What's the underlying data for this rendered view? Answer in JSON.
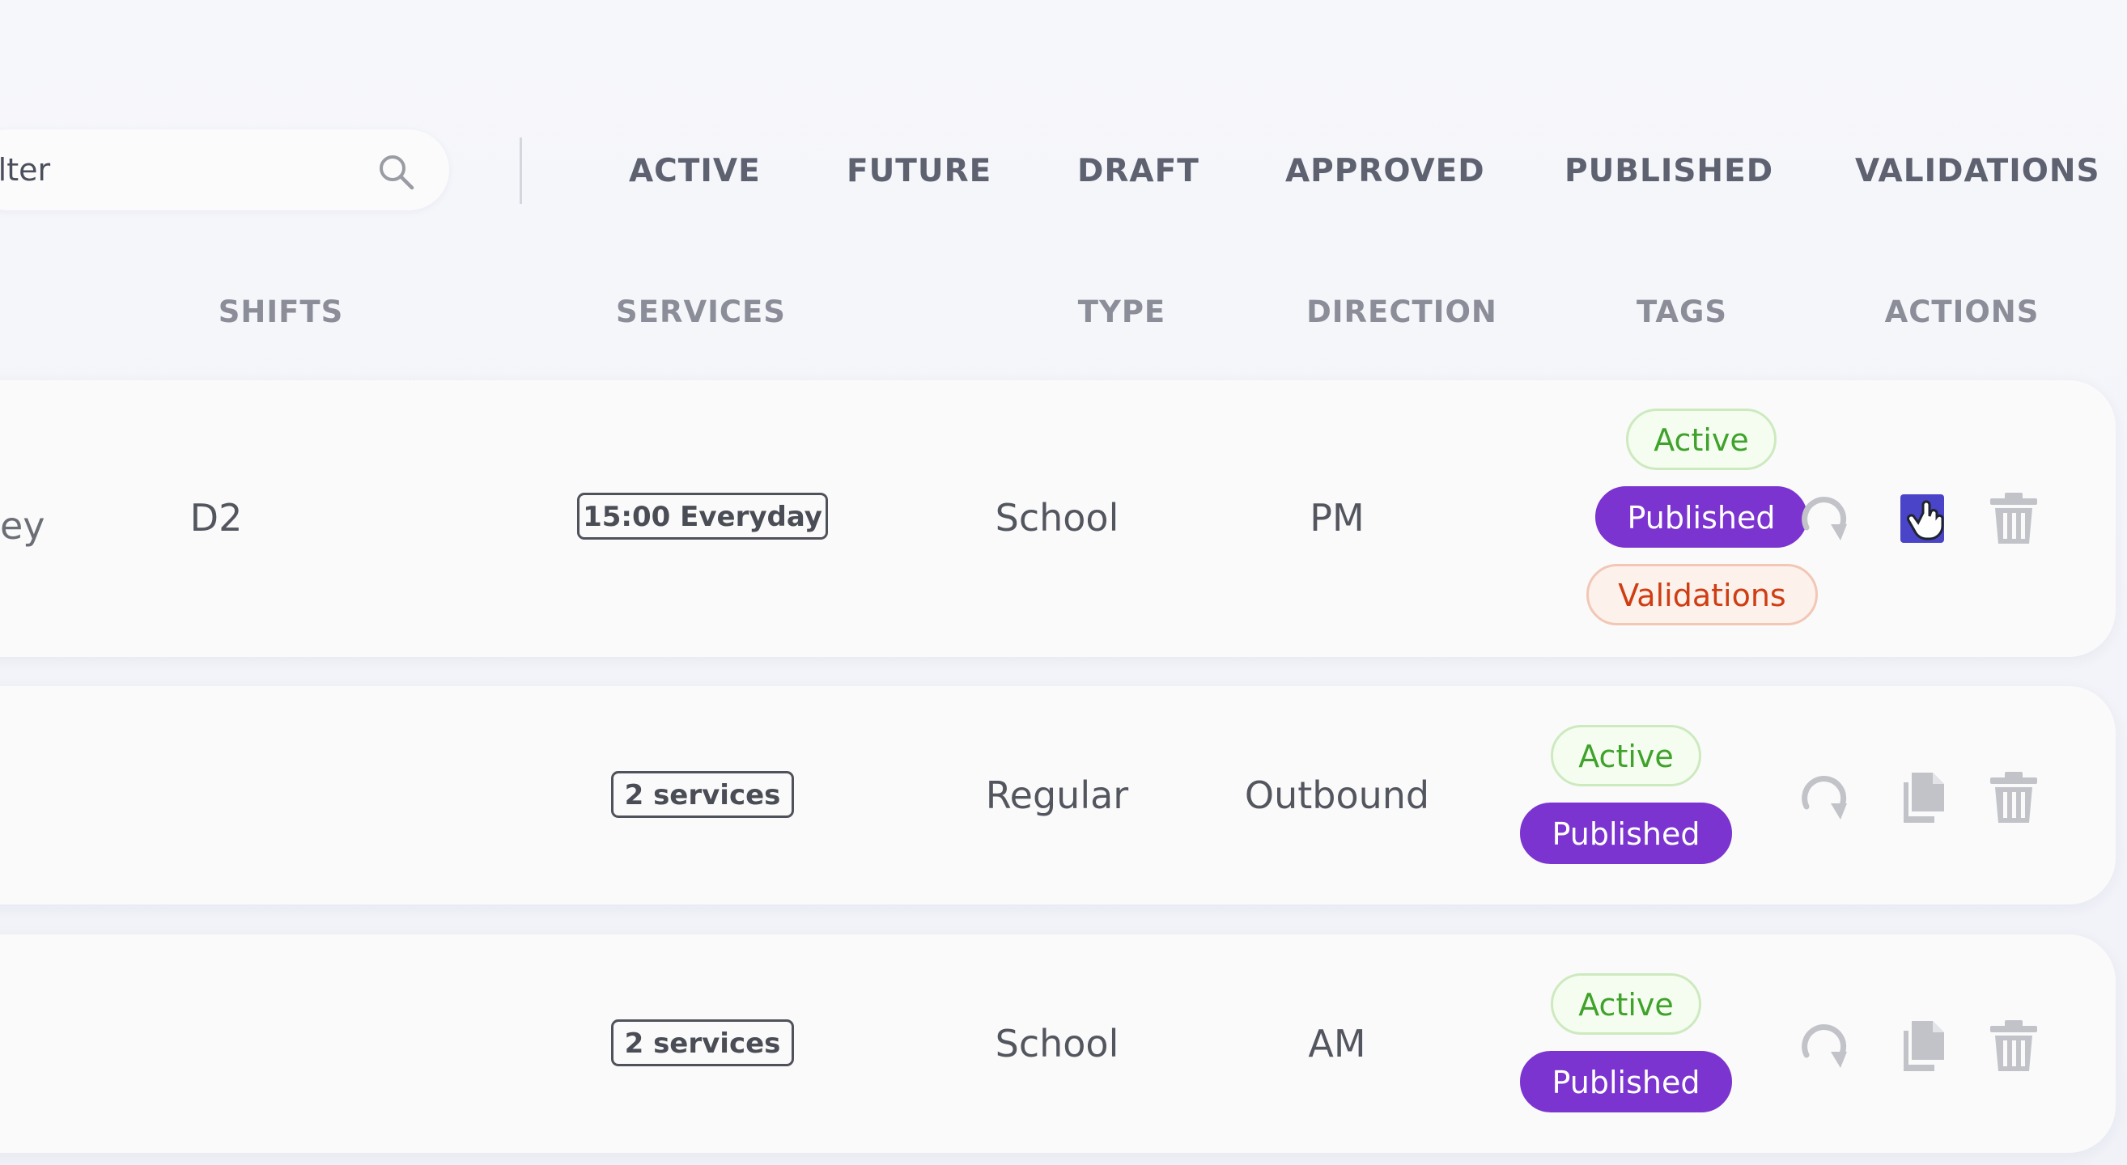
{
  "search": {
    "value": "Filter",
    "icon": "search-icon"
  },
  "status_tabs": [
    "ACTIVE",
    "FUTURE",
    "DRAFT",
    "APPROVED",
    "PUBLISHED",
    "VALIDATIONS"
  ],
  "columns": {
    "shifts": "SHIFTS",
    "services": "SERVICES",
    "type": "TYPE",
    "direction": "DIRECTION",
    "tags": "TAGS",
    "actions": "ACTIONS"
  },
  "rows": [
    {
      "name_fragment": "ey",
      "shift": "D2",
      "services": "15:00 Everyday",
      "type": "School",
      "direction": "PM",
      "tags": [
        "Active",
        "Published",
        "Validations"
      ]
    },
    {
      "name_fragment": "",
      "shift": "",
      "services": "2 services",
      "type": "Regular",
      "direction": "Outbound",
      "tags": [
        "Active",
        "Published"
      ]
    },
    {
      "name_fragment": "",
      "shift": "",
      "services": "2 services",
      "type": "School",
      "direction": "AM",
      "tags": [
        "Active",
        "Published"
      ]
    }
  ],
  "action_icons": [
    "refresh-icon",
    "copy-icon",
    "trash-icon"
  ],
  "colors": {
    "published": "#7b34cf",
    "active_text": "#3fa22a",
    "validations_text": "#cf3d12",
    "copy_hover": "#4a44c8"
  }
}
